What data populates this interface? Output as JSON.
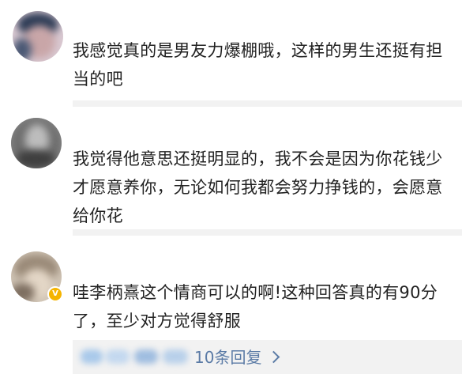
{
  "comments": [
    {
      "username": "",
      "text": "我感觉真的是男友力爆棚哦，这样的男生还挺有担当的吧"
    },
    {
      "username": "",
      "text": "我觉得他意思还挺明显的，我不会是因为你花钱少才愿意养你，无论如何我都会努力挣钱的，会愿意给你花"
    },
    {
      "username": "",
      "text": "哇李柄熹这个情商可以的啊!这种回答真的有90分了，至少对方觉得舒服"
    }
  ],
  "reply_bar": {
    "label": "10条回复",
    "link_color": "#5b7ba6"
  },
  "icons": {
    "avatar": "avatar-icon",
    "vip_badge": "vip-badge-icon",
    "chevron": "chevron-right-icon"
  },
  "colors": {
    "text": "#222222",
    "divider": "#f2f2f2",
    "link": "#5b7ba6",
    "vip": "#f5b400"
  }
}
